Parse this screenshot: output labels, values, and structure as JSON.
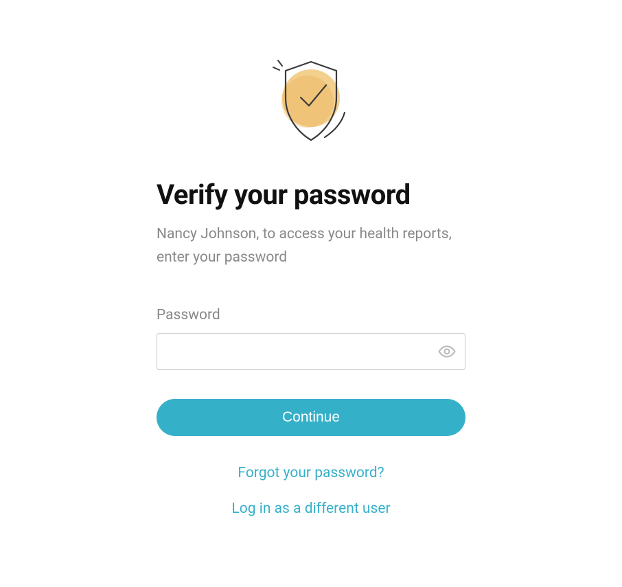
{
  "heading": "Verify your password",
  "subheading": "Nancy Johnson, to access your health reports, enter your password",
  "password": {
    "label": "Password",
    "value": "",
    "placeholder": ""
  },
  "buttons": {
    "continue": "Continue"
  },
  "links": {
    "forgot": "Forgot your password?",
    "different_user": "Log in as a different user"
  },
  "colors": {
    "accent": "#35b0c9",
    "text_muted": "#888888",
    "text_primary": "#111111",
    "border": "#cccccc"
  }
}
